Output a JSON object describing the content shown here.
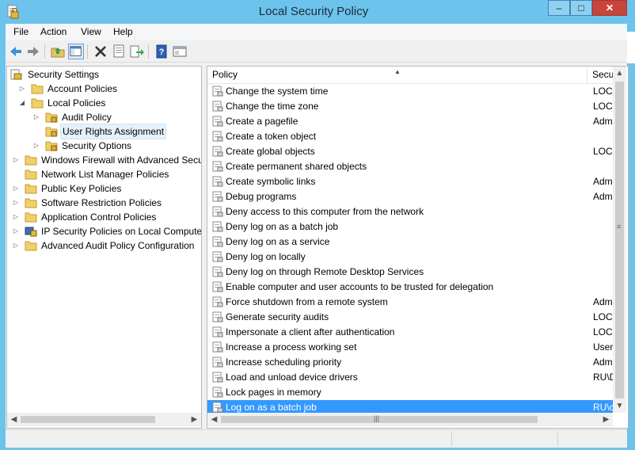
{
  "window": {
    "title": "Local Security Policy",
    "minimize": "–",
    "maximize": "□",
    "close": "✕"
  },
  "menu": [
    "File",
    "Action",
    "View",
    "Help"
  ],
  "toolbar": [
    "back-icon",
    "forward-icon",
    "up-folder-icon",
    "show-hide-tree-icon",
    "delete-icon",
    "properties-icon",
    "export-list-icon",
    "help-icon",
    "console-view-icon"
  ],
  "tree": {
    "root": "Security Settings",
    "items": [
      {
        "label": "Account Policies"
      },
      {
        "label": "Local Policies"
      },
      {
        "label": "Audit Policy"
      },
      {
        "label": "User Rights Assignment"
      },
      {
        "label": "Security Options"
      },
      {
        "label": "Windows Firewall with Advanced Secu"
      },
      {
        "label": "Network List Manager Policies"
      },
      {
        "label": "Public Key Policies"
      },
      {
        "label": "Software Restriction Policies"
      },
      {
        "label": "Application Control Policies"
      },
      {
        "label": "IP Security Policies on Local Compute"
      },
      {
        "label": "Advanced Audit Policy Configuration"
      }
    ]
  },
  "list": {
    "columns": [
      "Policy",
      "Secur"
    ],
    "rows": [
      {
        "policy": "Change the system time",
        "setting": "LOCA"
      },
      {
        "policy": "Change the time zone",
        "setting": "LOCA"
      },
      {
        "policy": "Create a pagefile",
        "setting": "Admi"
      },
      {
        "policy": "Create a token object",
        "setting": ""
      },
      {
        "policy": "Create global objects",
        "setting": "LOCA"
      },
      {
        "policy": "Create permanent shared objects",
        "setting": ""
      },
      {
        "policy": "Create symbolic links",
        "setting": "Admi"
      },
      {
        "policy": "Debug programs",
        "setting": "Admi"
      },
      {
        "policy": "Deny access to this computer from the network",
        "setting": ""
      },
      {
        "policy": "Deny log on as a batch job",
        "setting": ""
      },
      {
        "policy": "Deny log on as a service",
        "setting": ""
      },
      {
        "policy": "Deny log on locally",
        "setting": ""
      },
      {
        "policy": "Deny log on through Remote Desktop Services",
        "setting": ""
      },
      {
        "policy": "Enable computer and user accounts to be trusted for delegation",
        "setting": ""
      },
      {
        "policy": "Force shutdown from a remote system",
        "setting": "Admi"
      },
      {
        "policy": "Generate security audits",
        "setting": "LOCA"
      },
      {
        "policy": "Impersonate a client after authentication",
        "setting": "LOCA"
      },
      {
        "policy": "Increase a process working set",
        "setting": "Users,"
      },
      {
        "policy": "Increase scheduling priority",
        "setting": "Admi"
      },
      {
        "policy": "Load and unload device drivers",
        "setting": "RU\\DI"
      },
      {
        "policy": "Lock pages in memory",
        "setting": ""
      },
      {
        "policy": "Log on as a batch job",
        "setting": "RU\\co"
      }
    ],
    "selected_row": "Log on as a batch job"
  },
  "colors": {
    "frame": "#6cc3ec",
    "selection": "#3399ff",
    "close": "#c8453b"
  }
}
